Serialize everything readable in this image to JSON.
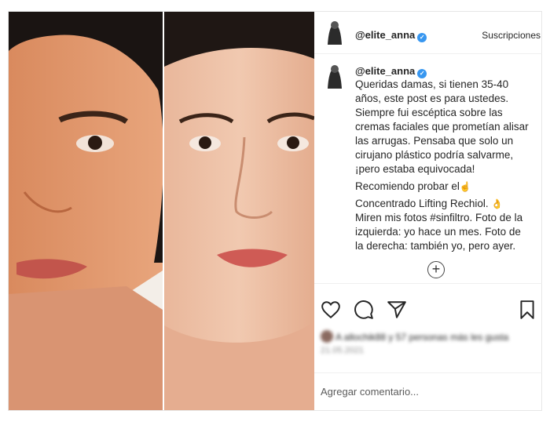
{
  "post": {
    "username": "@elite_anna",
    "follow_label": "Suscripciones",
    "caption_paragraphs": [
      "Queridas damas, si tienen 35-40 años, este post es para ustedes. Siempre fui escéptica sobre las cremas faciales que prometían alisar las arrugas. Pensaba que solo un cirujano plástico podría salvarme, ¡pero estaba equivocada!",
      "Recomiendo probar el",
      "Concentrado Lifting Rechiol.",
      "Miren mis fotos #sinfiltro. Foto de la izquierda: yo hace un mes. Foto de la derecha: también yo, pero ayer."
    ],
    "hand_emoji_1": "☝",
    "hand_emoji_2": "👌",
    "likes_text": "A allochik88 y 57 personas más les gusta",
    "date": "21.05.2021",
    "comment_placeholder": "Agregar comentario..."
  },
  "icons": [
    "verified-badge",
    "heart-icon",
    "comment-icon",
    "share-icon",
    "bookmark-icon",
    "plus-circle-icon"
  ],
  "colors": {
    "verified": "#3897f0",
    "border": "#e6e6e6",
    "text": "#262626"
  }
}
